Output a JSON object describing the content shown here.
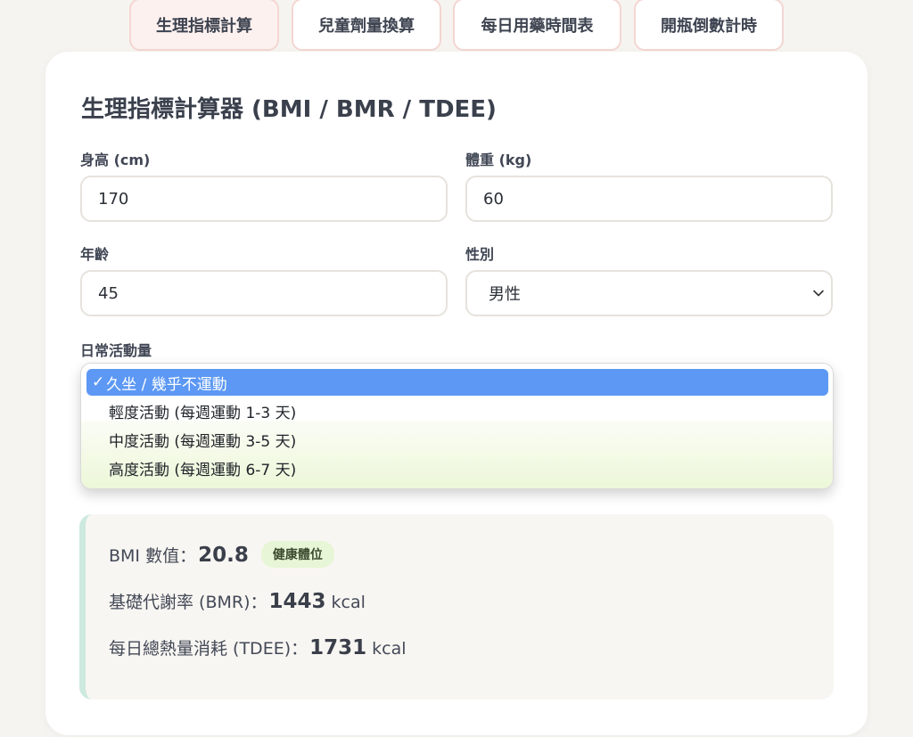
{
  "nav": {
    "tabs": [
      {
        "label": "生理指標計算",
        "active": true
      },
      {
        "label": "兒童劑量換算",
        "active": false
      },
      {
        "label": "每日用藥時間表",
        "active": false
      },
      {
        "label": "開瓶倒數計時",
        "active": false
      }
    ]
  },
  "calculator": {
    "title": "生理指標計算器 (BMI / BMR / TDEE)",
    "height": {
      "label": "身高 (cm)",
      "value": "170"
    },
    "weight": {
      "label": "體重 (kg)",
      "value": "60"
    },
    "age": {
      "label": "年齡",
      "value": "45"
    },
    "gender": {
      "label": "性別",
      "value": "男性"
    },
    "activity": {
      "label": "日常活動量",
      "options": [
        {
          "label": "久坐 / 幾乎不運動",
          "selected": true
        },
        {
          "label": "輕度活動 (每週運動 1-3 天)",
          "selected": false
        },
        {
          "label": "中度活動 (每週運動 3-5 天)",
          "selected": false
        },
        {
          "label": "高度活動 (每週運動 6-7 天)",
          "selected": false
        }
      ],
      "check_mark": "✓"
    }
  },
  "results": {
    "bmi": {
      "label": "BMI 數值：",
      "value": "20.8",
      "badge": "健康體位"
    },
    "bmr": {
      "label": "基礎代謝率 (BMR)：",
      "value": "1443",
      "unit": "kcal"
    },
    "tdee": {
      "label": "每日總熱量消耗 (TDEE)：",
      "value": "1731",
      "unit": "kcal"
    }
  },
  "colors": {
    "tab_border": "#f3d6d2",
    "selected_option": "#5c98f4",
    "badge_bg": "#e7f6d6",
    "result_accent": "#cde9e0"
  }
}
